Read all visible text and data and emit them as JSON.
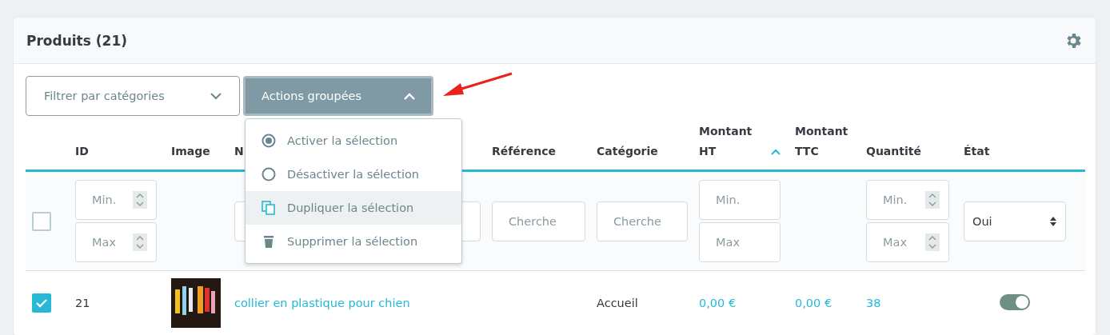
{
  "panel": {
    "title": "Produits (21)"
  },
  "toolbar": {
    "category_filter": {
      "label": "Filtrer par catégories"
    },
    "bulk_actions": {
      "label": "Actions groupées",
      "expanded": true
    }
  },
  "bulk_menu": [
    {
      "label": "Activer la sélection",
      "hovered": false
    },
    {
      "label": "Désactiver la sélection",
      "hovered": false
    },
    {
      "label": "Dupliquer la sélection",
      "hovered": true
    },
    {
      "label": "Supprimer la sélection",
      "hovered": false
    }
  ],
  "table": {
    "columns": [
      {},
      {
        "label": "ID",
        "sorted": false
      },
      {
        "label": "Image"
      },
      {
        "label": "N"
      },
      {
        "label": "Référence"
      },
      {
        "label": "Catégorie"
      },
      {
        "label": "Montant HT",
        "sorted": true
      },
      {
        "label": "Montant TTC"
      },
      {
        "label": "Quantité"
      },
      {
        "label": "État"
      }
    ],
    "filters": [
      {
        "kind": "checkbox",
        "checked": false
      },
      {
        "kind": "range",
        "min": {
          "placeholder": "Min."
        },
        "max": {
          "placeholder": "Max"
        },
        "spinner": true
      },
      {
        "kind": "none"
      },
      {
        "kind": "text"
      },
      {
        "kind": "text",
        "placeholder": "Cherche"
      },
      {
        "kind": "text",
        "placeholder": "Cherche"
      },
      {
        "kind": "range",
        "min": {
          "placeholder": "Min."
        },
        "max": {
          "placeholder": "Max"
        },
        "spinner": false
      },
      {
        "kind": "none"
      },
      {
        "kind": "range",
        "min": {
          "placeholder": "Min."
        },
        "max": {
          "placeholder": "Max"
        },
        "spinner": true
      },
      {
        "kind": "select",
        "value": "Oui"
      }
    ],
    "rows": [
      {
        "checked": true,
        "id": "21",
        "name": "collier en plastique pour chien",
        "category": "Accueil",
        "price_ht": "0,00 €",
        "price_ttc": "0,00 €",
        "quantity": "38",
        "active": true
      }
    ]
  }
}
